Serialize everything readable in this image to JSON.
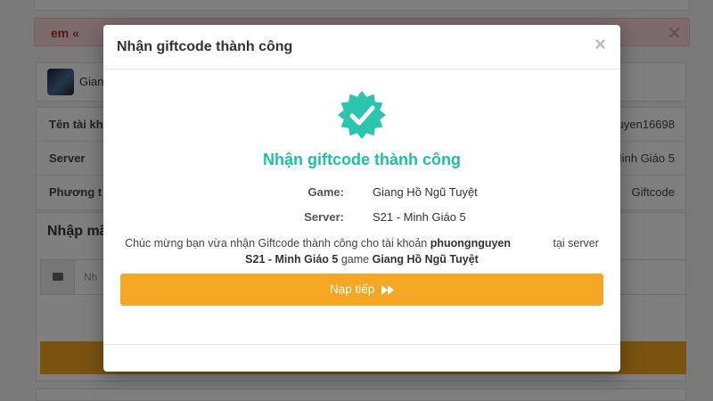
{
  "background": {
    "alert_text": "em «",
    "alert_close": "✕",
    "game_name": "Giang",
    "account_rows": [
      {
        "label": "Tên tài kh",
        "value": "uyen16698"
      },
      {
        "label": "Server",
        "value": "Minh Giáo 5"
      },
      {
        "label": "Phương t",
        "value": "Giftcode"
      }
    ],
    "form_title": "Nhập mã",
    "input_placeholder": "Nh"
  },
  "modal": {
    "title": "Nhận giftcode thành công",
    "close_symbol": "×",
    "success_heading": "Nhận giftcode thành công",
    "details": [
      {
        "label": "Game:",
        "value": "Giang Hồ Ngũ Tuyệt"
      },
      {
        "label": "Server:",
        "value": "S21 - Minh Giáo 5"
      }
    ],
    "message": {
      "prefix": "Chúc mừng bạn vừa nhận Giftcode thành công cho tài khoản",
      "account": "phuongnguyen",
      "at_server": "tại server",
      "server": "S21 - Minh Giáo 5",
      "game_word": "game",
      "game": "Giang Hồ Ngũ Tuyệt"
    },
    "button_label": "Nạp tiếp"
  },
  "colors": {
    "accent_orange": "#f5a623",
    "success_teal": "#1fbfa6",
    "alert_bg": "#f8d7da",
    "overlay": "rgba(0,0,0,0.5)"
  },
  "icons": {
    "success": "check-badge-icon",
    "button_arrow": "fast-forward-icon",
    "input_prefix": "card-icon"
  }
}
